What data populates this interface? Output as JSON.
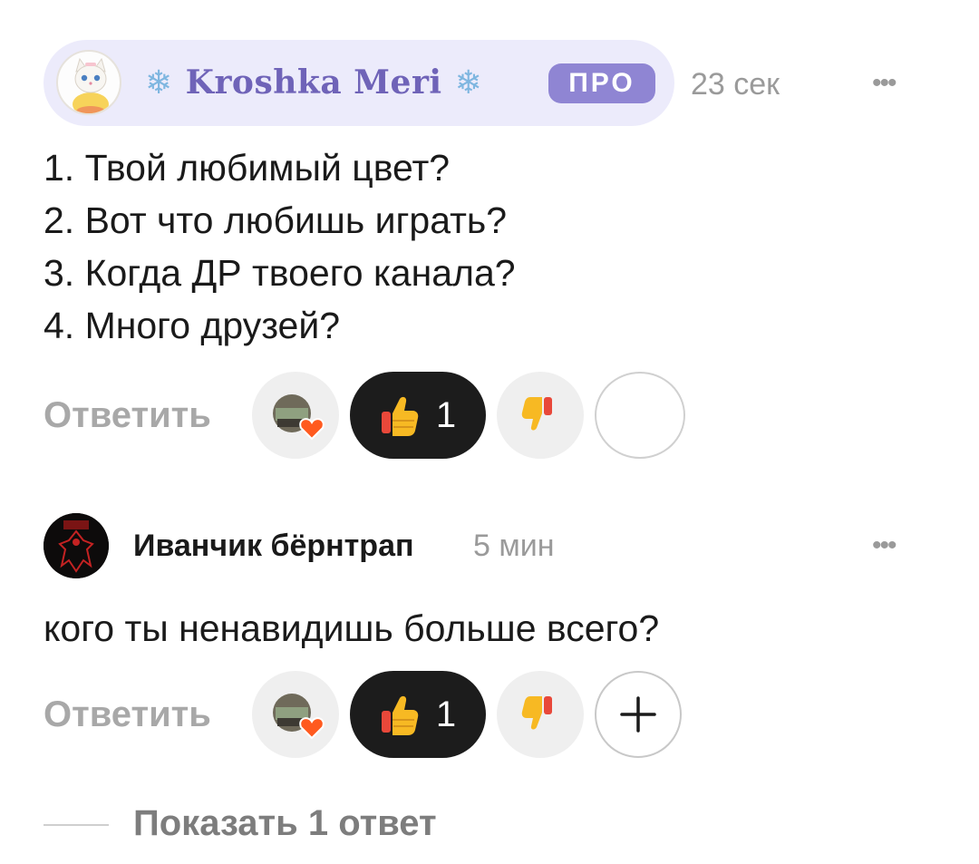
{
  "comment1": {
    "author": "Kroshka Meri",
    "author_decor": "❄",
    "badge": "ПРО",
    "time": "23 сек",
    "lines": [
      "1. Твой любимый цвет?",
      "2. Вот что любишь играть?",
      "3. Когда ДР твоего канала?",
      "4. Много друзей?"
    ],
    "reply_label": "Ответить",
    "like_count": "1",
    "more_label": "•••"
  },
  "comment2": {
    "author": "Иванчик бёрнтрап",
    "time": "5 мин",
    "text": "кого ты ненавидишь больше всего?",
    "reply_label": "Ответить",
    "like_count": "1",
    "more_label": "•••"
  },
  "show_replies": "Показать 1 ответ",
  "colors": {
    "pill_bg": "#ecebfb",
    "name_color": "#6f63b8",
    "badge_bg": "#8f85d3",
    "like_bg": "#1c1c1c",
    "heart": "#ff5a1f",
    "muted": "#9a9a9a"
  },
  "icons": [
    "kitty-avatar-icon",
    "snowflake-icon",
    "heart-reaction-icon",
    "thumbs-up-icon",
    "thumbs-down-icon",
    "plus-icon",
    "more-dots-icon",
    "dark-avatar-icon"
  ]
}
